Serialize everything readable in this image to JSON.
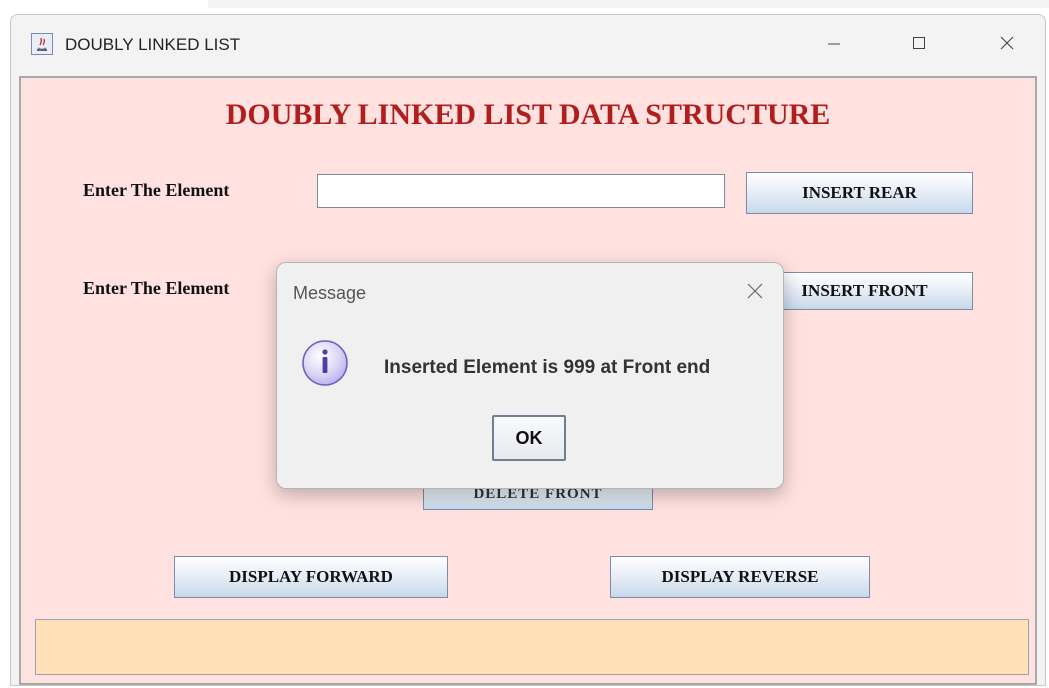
{
  "window": {
    "title": "DOUBLY LINKED LIST"
  },
  "main": {
    "heading": "DOUBLY LINKED LIST DATA STRUCTURE",
    "row1": {
      "label": "Enter The Element",
      "input_value": "",
      "button": "INSERT REAR"
    },
    "row2": {
      "label": "Enter The Element",
      "button": "INSERT FRONT"
    },
    "hidden_button": "DELETE FRONT",
    "display_forward": "DISPLAY FORWARD",
    "display_reverse": "DISPLAY REVERSE",
    "output_text": ""
  },
  "dialog": {
    "title": "Message",
    "message": "Inserted Element is 999 at Front end",
    "ok_label": "OK",
    "icon": "info-icon"
  },
  "colors": {
    "client_bg": "#ffe1df",
    "heading": "#b01e1e",
    "output_bg": "#ffdfb5"
  }
}
